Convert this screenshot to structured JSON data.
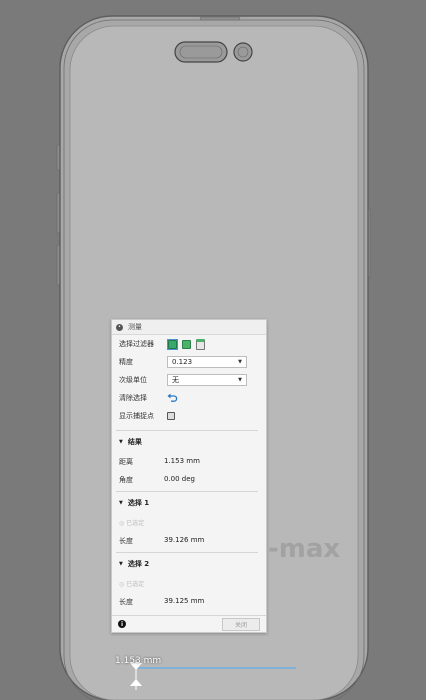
{
  "viewport": {
    "watermark": "-max"
  },
  "dialog": {
    "title": "测量",
    "selection_filter_label": "选择过滤器",
    "precision_label": "精度",
    "precision_value": "0.123",
    "secondary_unit_label": "次级单位",
    "secondary_unit_value": "无",
    "clear_selection_label": "清除选择",
    "show_snap_label": "显示捕捉点",
    "results": {
      "title": "结果",
      "distance_label": "距离",
      "distance_value": "1.153 mm",
      "angle_label": "角度",
      "angle_value": "0.00 deg"
    },
    "selection1": {
      "title": "选择 1",
      "selected_text": "已选定",
      "length_label": "长度",
      "length_value": "39.126 mm"
    },
    "selection2": {
      "title": "选择 2",
      "selected_text": "已选定",
      "length_label": "长度",
      "length_value": "39.125 mm"
    },
    "close_label": "关闭"
  },
  "measure_label": "1.153 mm",
  "colors": {
    "accent": "#4c92d0",
    "face_filter": "#3aa76d",
    "body_filter": "#49b36a"
  }
}
